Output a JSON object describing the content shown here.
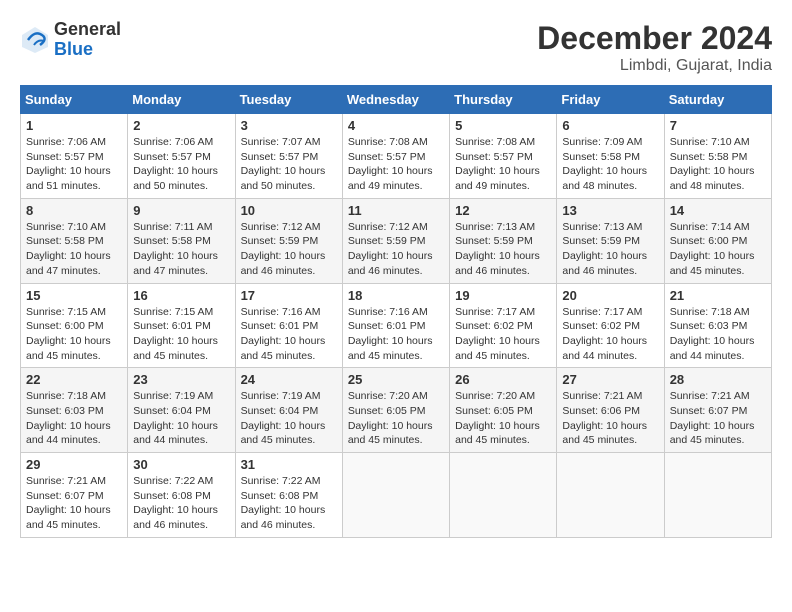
{
  "logo": {
    "general": "General",
    "blue": "Blue"
  },
  "header": {
    "title": "December 2024",
    "location": "Limbdi, Gujarat, India"
  },
  "weekdays": [
    "Sunday",
    "Monday",
    "Tuesday",
    "Wednesday",
    "Thursday",
    "Friday",
    "Saturday"
  ],
  "weeks": [
    [
      {
        "day": "1",
        "sunrise": "7:06 AM",
        "sunset": "5:57 PM",
        "daylight": "10 hours and 51 minutes."
      },
      {
        "day": "2",
        "sunrise": "7:06 AM",
        "sunset": "5:57 PM",
        "daylight": "10 hours and 50 minutes."
      },
      {
        "day": "3",
        "sunrise": "7:07 AM",
        "sunset": "5:57 PM",
        "daylight": "10 hours and 50 minutes."
      },
      {
        "day": "4",
        "sunrise": "7:08 AM",
        "sunset": "5:57 PM",
        "daylight": "10 hours and 49 minutes."
      },
      {
        "day": "5",
        "sunrise": "7:08 AM",
        "sunset": "5:57 PM",
        "daylight": "10 hours and 49 minutes."
      },
      {
        "day": "6",
        "sunrise": "7:09 AM",
        "sunset": "5:58 PM",
        "daylight": "10 hours and 48 minutes."
      },
      {
        "day": "7",
        "sunrise": "7:10 AM",
        "sunset": "5:58 PM",
        "daylight": "10 hours and 48 minutes."
      }
    ],
    [
      {
        "day": "8",
        "sunrise": "7:10 AM",
        "sunset": "5:58 PM",
        "daylight": "10 hours and 47 minutes."
      },
      {
        "day": "9",
        "sunrise": "7:11 AM",
        "sunset": "5:58 PM",
        "daylight": "10 hours and 47 minutes."
      },
      {
        "day": "10",
        "sunrise": "7:12 AM",
        "sunset": "5:59 PM",
        "daylight": "10 hours and 46 minutes."
      },
      {
        "day": "11",
        "sunrise": "7:12 AM",
        "sunset": "5:59 PM",
        "daylight": "10 hours and 46 minutes."
      },
      {
        "day": "12",
        "sunrise": "7:13 AM",
        "sunset": "5:59 PM",
        "daylight": "10 hours and 46 minutes."
      },
      {
        "day": "13",
        "sunrise": "7:13 AM",
        "sunset": "5:59 PM",
        "daylight": "10 hours and 46 minutes."
      },
      {
        "day": "14",
        "sunrise": "7:14 AM",
        "sunset": "6:00 PM",
        "daylight": "10 hours and 45 minutes."
      }
    ],
    [
      {
        "day": "15",
        "sunrise": "7:15 AM",
        "sunset": "6:00 PM",
        "daylight": "10 hours and 45 minutes."
      },
      {
        "day": "16",
        "sunrise": "7:15 AM",
        "sunset": "6:01 PM",
        "daylight": "10 hours and 45 minutes."
      },
      {
        "day": "17",
        "sunrise": "7:16 AM",
        "sunset": "6:01 PM",
        "daylight": "10 hours and 45 minutes."
      },
      {
        "day": "18",
        "sunrise": "7:16 AM",
        "sunset": "6:01 PM",
        "daylight": "10 hours and 45 minutes."
      },
      {
        "day": "19",
        "sunrise": "7:17 AM",
        "sunset": "6:02 PM",
        "daylight": "10 hours and 45 minutes."
      },
      {
        "day": "20",
        "sunrise": "7:17 AM",
        "sunset": "6:02 PM",
        "daylight": "10 hours and 44 minutes."
      },
      {
        "day": "21",
        "sunrise": "7:18 AM",
        "sunset": "6:03 PM",
        "daylight": "10 hours and 44 minutes."
      }
    ],
    [
      {
        "day": "22",
        "sunrise": "7:18 AM",
        "sunset": "6:03 PM",
        "daylight": "10 hours and 44 minutes."
      },
      {
        "day": "23",
        "sunrise": "7:19 AM",
        "sunset": "6:04 PM",
        "daylight": "10 hours and 44 minutes."
      },
      {
        "day": "24",
        "sunrise": "7:19 AM",
        "sunset": "6:04 PM",
        "daylight": "10 hours and 45 minutes."
      },
      {
        "day": "25",
        "sunrise": "7:20 AM",
        "sunset": "6:05 PM",
        "daylight": "10 hours and 45 minutes."
      },
      {
        "day": "26",
        "sunrise": "7:20 AM",
        "sunset": "6:05 PM",
        "daylight": "10 hours and 45 minutes."
      },
      {
        "day": "27",
        "sunrise": "7:21 AM",
        "sunset": "6:06 PM",
        "daylight": "10 hours and 45 minutes."
      },
      {
        "day": "28",
        "sunrise": "7:21 AM",
        "sunset": "6:07 PM",
        "daylight": "10 hours and 45 minutes."
      }
    ],
    [
      {
        "day": "29",
        "sunrise": "7:21 AM",
        "sunset": "6:07 PM",
        "daylight": "10 hours and 45 minutes."
      },
      {
        "day": "30",
        "sunrise": "7:22 AM",
        "sunset": "6:08 PM",
        "daylight": "10 hours and 46 minutes."
      },
      {
        "day": "31",
        "sunrise": "7:22 AM",
        "sunset": "6:08 PM",
        "daylight": "10 hours and 46 minutes."
      },
      null,
      null,
      null,
      null
    ]
  ]
}
